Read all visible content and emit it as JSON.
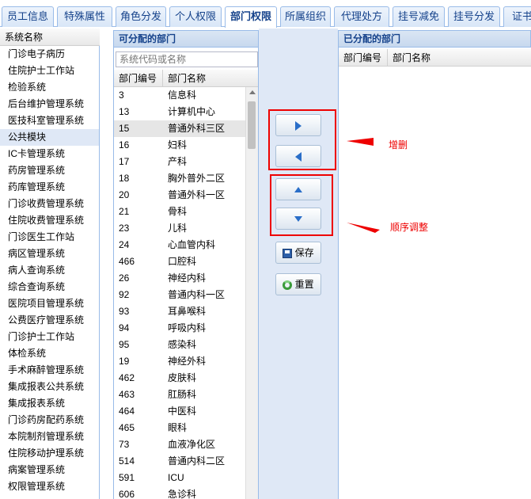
{
  "tabs": [
    "员工信息",
    "特殊属性",
    "角色分发",
    "个人权限",
    "部门权限",
    "所属组织",
    "代理处方",
    "挂号减免",
    "挂号分发",
    "证书"
  ],
  "active_tab": "部门权限",
  "system_list": {
    "header": "系统名称",
    "items": [
      "门诊电子病历",
      "住院护士工作站",
      "检验系统",
      "后台维护管理系统",
      "医技科室管理系统",
      "公共模块",
      "IC卡管理系统",
      "药房管理系统",
      "药库管理系统",
      "门诊收费管理系统",
      "住院收费管理系统",
      "门诊医生工作站",
      "病区管理系统",
      "病人查询系统",
      "综合查询系统",
      "医院项目管理系统",
      "公费医疗管理系统",
      "门诊护士工作站",
      "体检系统",
      "手术麻醉管理系统",
      "集成报表公共系统",
      "集成报表系统",
      "门诊药房配药系统",
      "本院制剂管理系统",
      "住院移动护理系统",
      "病案管理系统",
      "权限管理系统"
    ],
    "selected": "公共模块"
  },
  "available": {
    "title": "可分配的部门",
    "search_placeholder": "系统代码或名称",
    "col_code": "部门编号",
    "col_name": "部门名称",
    "rows": [
      [
        "3",
        "信息科"
      ],
      [
        "13",
        "计算机中心"
      ],
      [
        "15",
        "普通外科三区"
      ],
      [
        "16",
        "妇科"
      ],
      [
        "17",
        "产科"
      ],
      [
        "18",
        "胸外普外二区"
      ],
      [
        "20",
        "普通外科一区"
      ],
      [
        "21",
        "骨科"
      ],
      [
        "23",
        "儿科"
      ],
      [
        "24",
        "心血管内科"
      ],
      [
        "466",
        "口腔科"
      ],
      [
        "26",
        "神经内科"
      ],
      [
        "92",
        "普通内科一区"
      ],
      [
        "93",
        "耳鼻喉科"
      ],
      [
        "94",
        "呼吸内科"
      ],
      [
        "95",
        "感染科"
      ],
      [
        "19",
        "神经外科"
      ],
      [
        "462",
        "皮肤科"
      ],
      [
        "463",
        "肛肠科"
      ],
      [
        "464",
        "中医科"
      ],
      [
        "465",
        "眼科"
      ],
      [
        "73",
        "血液净化区"
      ],
      [
        "514",
        "普通内科二区"
      ],
      [
        "591",
        "ICU"
      ],
      [
        "606",
        "急诊科"
      ]
    ],
    "selected_code": "15"
  },
  "assigned": {
    "title": "已分配的部门",
    "col_code": "部门编号",
    "col_name": "部门名称"
  },
  "buttons": {
    "save": "保存",
    "reset": "重置"
  },
  "annotations": {
    "add_remove": "增删",
    "reorder": "顺序调整"
  }
}
